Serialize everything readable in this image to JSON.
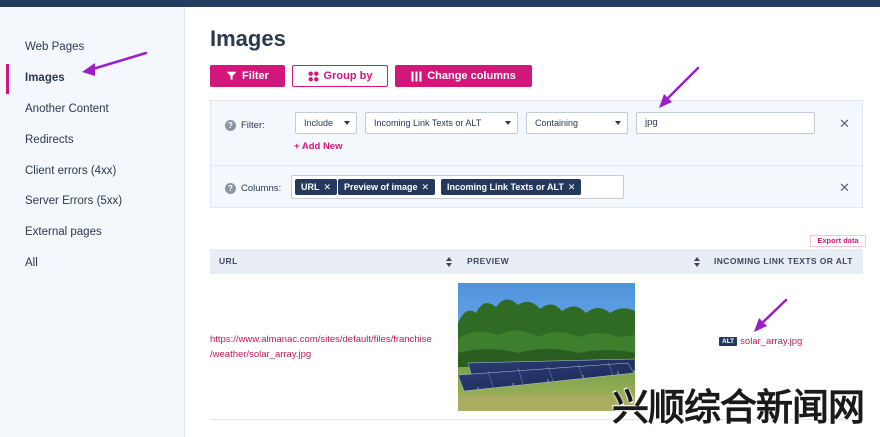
{
  "sidebar": {
    "items": [
      {
        "label": "Web Pages"
      },
      {
        "label": "Images"
      },
      {
        "label": "Another Content"
      },
      {
        "label": "Redirects"
      },
      {
        "label": "Client errors (4xx)"
      },
      {
        "label": "Server Errors (5xx)"
      },
      {
        "label": "External pages"
      },
      {
        "label": "All"
      }
    ],
    "active_index": 1
  },
  "page": {
    "title": "Images"
  },
  "toolbar": {
    "filter_label": "Filter",
    "group_by_label": "Group by",
    "change_columns_label": "Change columns"
  },
  "filter": {
    "label": "Filter:",
    "mode_select": "Include",
    "field_select": "Incoming Link Texts or ALT",
    "operator_select": "Containing",
    "value": "jpg",
    "add_new_label": "+ Add New"
  },
  "columns": {
    "label": "Columns:",
    "tags": [
      "URL",
      "Preview of image",
      "Incoming Link Texts or ALT"
    ]
  },
  "table": {
    "export_label": "Export data",
    "headers": [
      "URL",
      "PREVIEW",
      "INCOMING LINK TEXTS OR ALT"
    ],
    "rows": [
      {
        "url_line1": "https://www.almanac.com/sites/default/files/franchise",
        "url_line2": "/weather/solar_array.jpg",
        "alt_badge": "ALT",
        "alt_text": "solar_array.jpg"
      }
    ]
  },
  "watermark": {
    "text": "兴顺综合新闻网"
  },
  "colors": {
    "accent": "#d2177a",
    "navy": "#24395d",
    "annotation_arrow": "#9b1fc9"
  }
}
